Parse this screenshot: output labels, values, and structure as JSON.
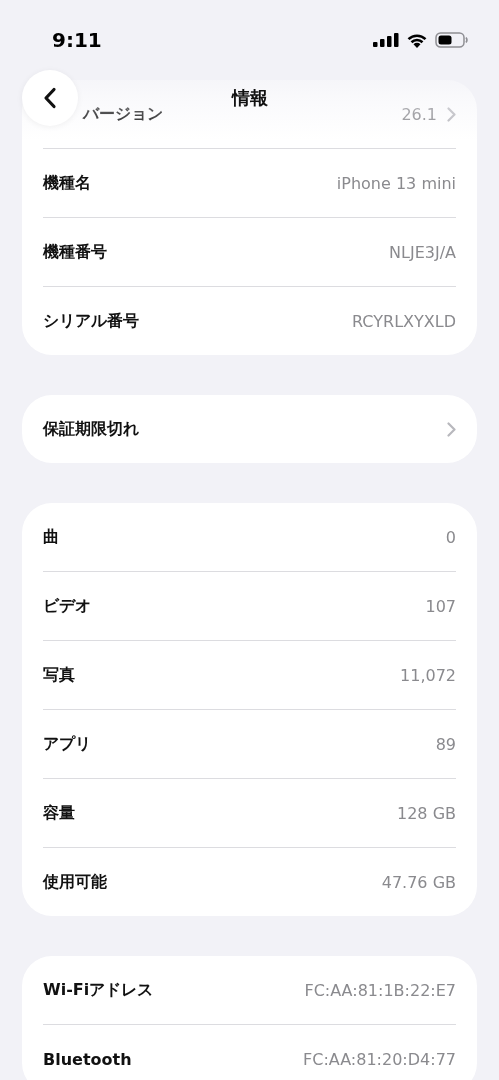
{
  "status_bar": {
    "time": "9:11"
  },
  "nav": {
    "title": "情報"
  },
  "sections": [
    {
      "rows": [
        {
          "label": "バージョン",
          "value": "26.1",
          "chevron": true
        },
        {
          "label": "機種名",
          "value": "iPhone 13 mini"
        },
        {
          "label": "機種番号",
          "value": "NLJE3J/A"
        },
        {
          "label": "シリアル番号",
          "value": "RCYRLXYXLD"
        }
      ]
    },
    {
      "rows": [
        {
          "label": "保証期限切れ",
          "chevron": true
        }
      ]
    },
    {
      "rows": [
        {
          "label": "曲",
          "value": "0"
        },
        {
          "label": "ビデオ",
          "value": "107"
        },
        {
          "label": "写真",
          "value": "11,072"
        },
        {
          "label": "アプリ",
          "value": "89"
        },
        {
          "label": "容量",
          "value": "128 GB"
        },
        {
          "label": "使用可能",
          "value": "47.76 GB"
        }
      ]
    },
    {
      "rows": [
        {
          "label": "Wi-Fiアドレス",
          "value": "FC:AA:81:1B:22:E7"
        },
        {
          "label": "Bluetooth",
          "value": "FC:AA:81:20:D4:77"
        }
      ]
    }
  ]
}
